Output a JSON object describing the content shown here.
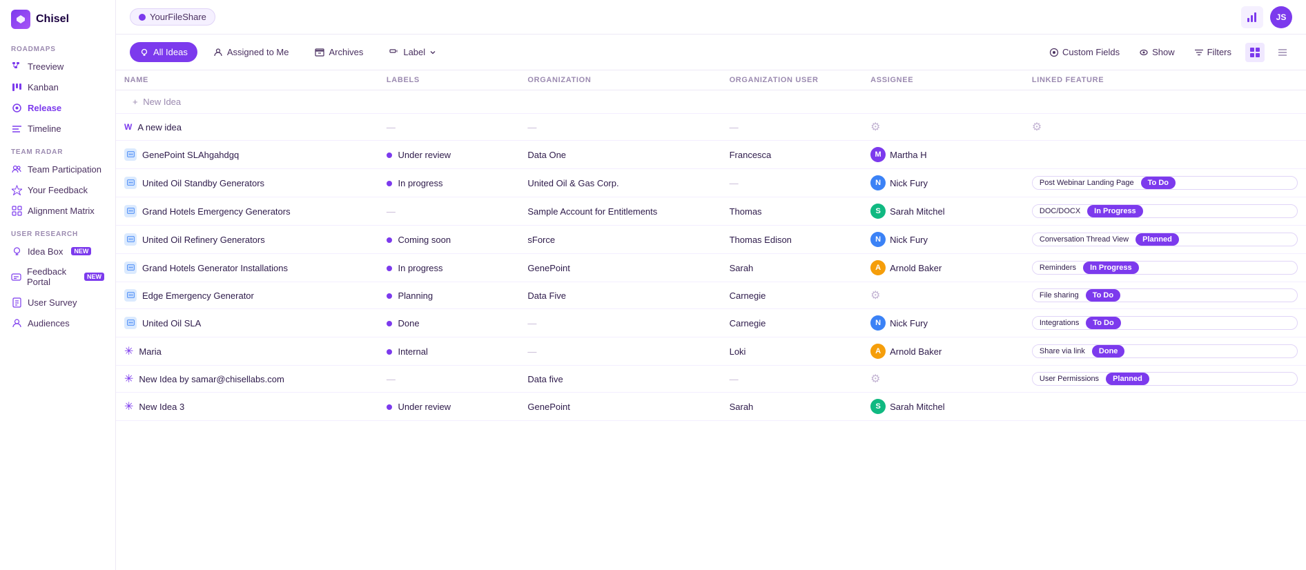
{
  "app": {
    "name": "Chisel"
  },
  "workspace": {
    "name": "YourFileShare"
  },
  "topbar": {
    "avatar_initials": "JS"
  },
  "toolbar": {
    "all_ideas_label": "All Ideas",
    "assigned_to_me_label": "Assigned to Me",
    "archives_label": "Archives",
    "label_label": "Label",
    "custom_fields_label": "Custom Fields",
    "show_label": "Show",
    "filters_label": "Filters"
  },
  "sidebar": {
    "logo_text": "Chisel",
    "sections": [
      {
        "label": "ROADMAPS",
        "items": [
          {
            "id": "treeview",
            "label": "Treeview",
            "icon": "tree"
          },
          {
            "id": "kanban",
            "label": "Kanban",
            "icon": "kanban"
          },
          {
            "id": "release",
            "label": "Release",
            "icon": "release"
          },
          {
            "id": "timeline",
            "label": "Timeline",
            "icon": "timeline"
          }
        ]
      },
      {
        "label": "TEAM RADAR",
        "items": [
          {
            "id": "team-participation",
            "label": "Team Participation",
            "icon": "team"
          },
          {
            "id": "your-feedback",
            "label": "Your Feedback",
            "icon": "feedback"
          },
          {
            "id": "alignment-matrix",
            "label": "Alignment Matrix",
            "icon": "matrix"
          }
        ]
      },
      {
        "label": "USER RESEARCH",
        "items": [
          {
            "id": "idea-box",
            "label": "Idea Box",
            "icon": "idea",
            "badge": "NEW"
          },
          {
            "id": "feedback-portal",
            "label": "Feedback Portal",
            "icon": "portal",
            "badge": "NEW"
          },
          {
            "id": "user-survey",
            "label": "User Survey",
            "icon": "survey"
          },
          {
            "id": "audiences",
            "label": "Audiences",
            "icon": "audiences"
          }
        ]
      }
    ]
  },
  "table": {
    "columns": [
      "NAME",
      "LABELS",
      "ORGANIZATION",
      "ORGANIZATION USER",
      "ASSIGNEE",
      "LINKED FEATURE"
    ],
    "new_idea_placeholder": "New Idea",
    "rows": [
      {
        "id": 1,
        "icon_type": "W",
        "name": "A new idea",
        "label": null,
        "label_color": null,
        "organization": null,
        "org_user": null,
        "assignee": null,
        "assignee_initials": null,
        "assignee_color": null,
        "linked_feature": null,
        "linked_status": null,
        "linked_status_class": null
      },
      {
        "id": 2,
        "icon_type": "chat",
        "name": "GenePoint SLAhgahdgq",
        "label": "Under review",
        "label_color": "#7c3aed",
        "organization": "Data One",
        "org_user": "Francesca",
        "assignee": "Martha H",
        "assignee_initials": "M",
        "assignee_color": "av-m",
        "linked_feature": null,
        "linked_status": null,
        "linked_status_class": null
      },
      {
        "id": 3,
        "icon_type": "chat",
        "name": "United Oil Standby Generators",
        "label": "In progress",
        "label_color": "#7c3aed",
        "organization": "United Oil & Gas Corp.",
        "org_user": null,
        "assignee": "Nick Fury",
        "assignee_initials": "N",
        "assignee_color": "av-n",
        "linked_feature": "Post Webinar Landing Page",
        "linked_status": "To Do",
        "linked_status_class": "status-todo"
      },
      {
        "id": 4,
        "icon_type": "chat",
        "name": "Grand Hotels Emergency Generators",
        "label": null,
        "label_color": null,
        "organization": "Sample Account for Entitlements",
        "org_user": "Thomas",
        "assignee": "Sarah Mitchel",
        "assignee_initials": "S",
        "assignee_color": "av-s",
        "linked_feature": "DOC/DOCX",
        "linked_status": "In Progress",
        "linked_status_class": "status-inprogress"
      },
      {
        "id": 5,
        "icon_type": "chat",
        "name": "United Oil Refinery Generators",
        "label": "Coming soon",
        "label_color": "#7c3aed",
        "organization": "sForce",
        "org_user": "Thomas Edison",
        "assignee": "Nick Fury",
        "assignee_initials": "N",
        "assignee_color": "av-n",
        "linked_feature": "Conversation Thread View",
        "linked_status": "Planned",
        "linked_status_class": "status-planned"
      },
      {
        "id": 6,
        "icon_type": "chat",
        "name": "Grand Hotels Generator Installations",
        "label": "In progress",
        "label_color": "#7c3aed",
        "organization": "GenePoint",
        "org_user": "Sarah",
        "assignee": "Arnold Baker",
        "assignee_initials": "A",
        "assignee_color": "av-a",
        "linked_feature": "Reminders",
        "linked_status": "In Progress",
        "linked_status_class": "status-inprogress"
      },
      {
        "id": 7,
        "icon_type": "chat",
        "name": "Edge Emergency Generator",
        "label": "Planning",
        "label_color": "#7c3aed",
        "organization": "Data Five",
        "org_user": "Carnegie",
        "assignee": null,
        "assignee_initials": null,
        "assignee_color": null,
        "linked_feature": "File sharing",
        "linked_status": "To Do",
        "linked_status_class": "status-todo"
      },
      {
        "id": 8,
        "icon_type": "chat",
        "name": "United Oil SLA",
        "label": "Done",
        "label_color": "#7c3aed",
        "organization": null,
        "org_user": "Carnegie",
        "assignee": "Nick Fury",
        "assignee_initials": "N",
        "assignee_color": "av-n",
        "linked_feature": "Integrations",
        "linked_status": "To Do",
        "linked_status_class": "status-todo"
      },
      {
        "id": 9,
        "icon_type": "asterisk",
        "name": "Maria",
        "label": "Internal",
        "label_color": "#7c3aed",
        "organization": null,
        "org_user": "Loki",
        "assignee": "Arnold Baker",
        "assignee_initials": "A",
        "assignee_color": "av-a",
        "linked_feature": "Share via link",
        "linked_status": "Done",
        "linked_status_class": "status-done"
      },
      {
        "id": 10,
        "icon_type": "asterisk",
        "name": "New Idea by samar@chisellabs.com",
        "label": null,
        "label_color": null,
        "organization": "Data five",
        "org_user": null,
        "assignee": null,
        "assignee_initials": null,
        "assignee_color": null,
        "linked_feature": "User Permissions",
        "linked_status": "Planned",
        "linked_status_class": "status-planned"
      },
      {
        "id": 11,
        "icon_type": "asterisk",
        "name": "New Idea 3",
        "label": "Under review",
        "label_color": "#7c3aed",
        "organization": "GenePoint",
        "org_user": "Sarah",
        "assignee": "Sarah Mitchel",
        "assignee_initials": "S",
        "assignee_color": "av-s",
        "linked_feature": null,
        "linked_status": null,
        "linked_status_class": null
      }
    ]
  }
}
